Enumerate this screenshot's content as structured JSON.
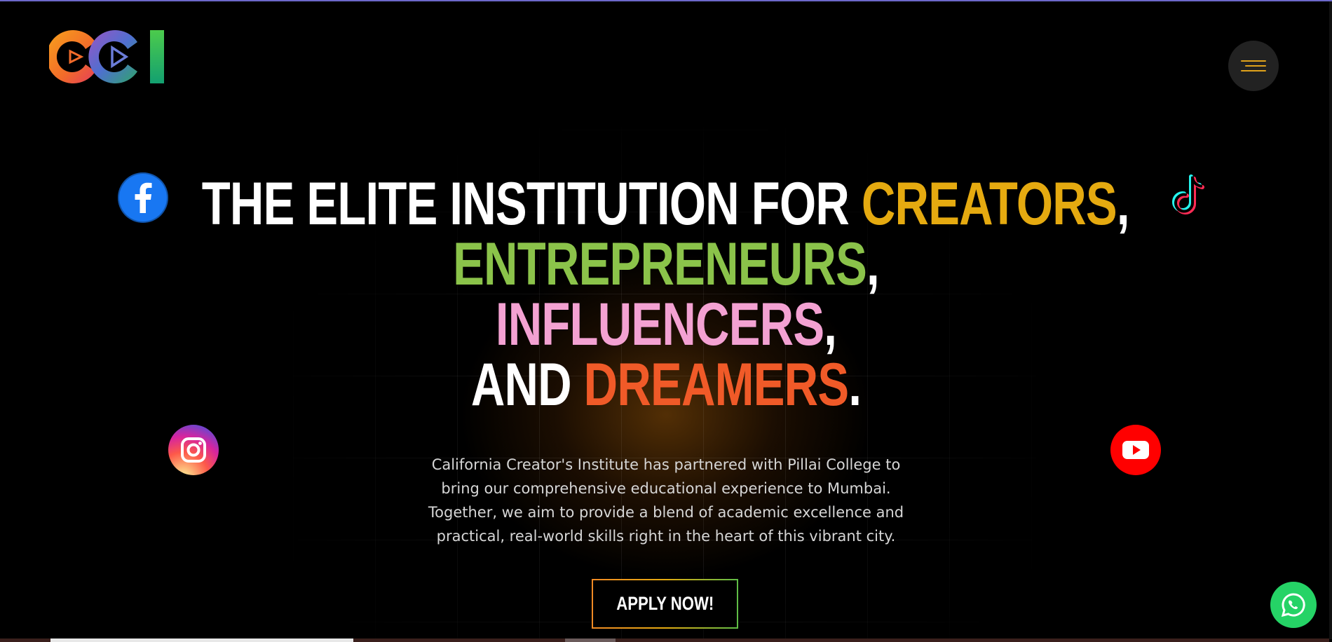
{
  "brand": {
    "logo_text": "CCI",
    "colors": {
      "yellow": "#e5aa10",
      "green": "#8bc34a",
      "pink": "#f3a1d2",
      "orange": "#f05a28",
      "menu_lines": "#e0a21b"
    }
  },
  "nav": {
    "menu_icon": "hamburger-menu-icon"
  },
  "socials": [
    {
      "name": "facebook",
      "icon": "facebook-icon",
      "color": "#1877f2"
    },
    {
      "name": "instagram",
      "icon": "instagram-icon"
    },
    {
      "name": "tiktok",
      "icon": "tiktok-icon"
    },
    {
      "name": "youtube",
      "icon": "youtube-icon",
      "color": "#ff0000"
    }
  ],
  "hero": {
    "line1_white": "THE ELITE INSTITUTION FOR ",
    "line1_yellow": "CREATORS",
    "line1_punct": ",",
    "line2_green": "ENTREPRENEURS",
    "line2_punct": ",",
    "line3_pink": "INFLUENCERS",
    "line3_punct": ",",
    "line4_white": "AND ",
    "line4_orange": "DREAMERS",
    "line4_punct": ".",
    "description_lines": [
      "California Creator's Institute has partnered with Pillai College to",
      "bring our comprehensive educational experience to Mumbai.",
      "Together, we aim to provide a blend of academic excellence and",
      "practical, real-world skills right in the heart of this vibrant city."
    ],
    "cta_label": "APPLY NOW!"
  },
  "floating": {
    "whatsapp_icon": "whatsapp-icon"
  }
}
